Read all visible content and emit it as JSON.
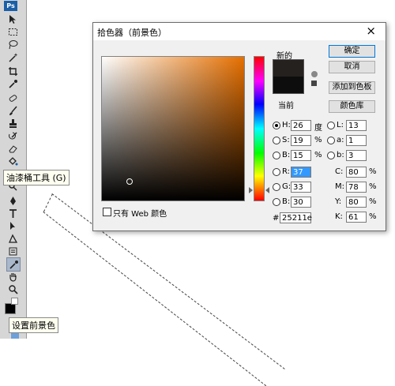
{
  "app": {
    "logo": "Ps"
  },
  "toolbar": {
    "tooltip_paint_bucket": "油漆桶工具 (G)",
    "tooltip_foreground": "设置前景色"
  },
  "dialog": {
    "title": "拾色器（前景色）",
    "close": "×",
    "swatch": {
      "new_label": "新的",
      "current_label": "当前"
    },
    "buttons": {
      "ok": "确定",
      "cancel": "取消",
      "add_to_swatches": "添加到色板",
      "color_libraries": "颜色库"
    },
    "web_only_label": "只有 Web 颜色",
    "hsb": {
      "h_label": "H:",
      "h_value": "26",
      "h_unit": "度",
      "s_label": "S:",
      "s_value": "19",
      "s_unit": "%",
      "b_label": "B:",
      "b_value": "15",
      "b_unit": "%"
    },
    "rgb": {
      "r_label": "R:",
      "r_value": "37",
      "g_label": "G:",
      "g_value": "33",
      "b_label": "B:",
      "b_value": "30"
    },
    "lab": {
      "l_label": "L:",
      "l_value": "13",
      "a_label": "a:",
      "a_value": "1",
      "b_label": "b:",
      "b_value": "3"
    },
    "cmyk": {
      "c_label": "C:",
      "c_value": "80",
      "m_label": "M:",
      "m_value": "78",
      "y_label": "Y:",
      "y_value": "80",
      "k_label": "K:",
      "k_value": "61",
      "unit": "%"
    },
    "hex_label": "#",
    "hex_value": "25211e"
  },
  "colors": {
    "foreground": "#25211e",
    "current": "#0d0d0d",
    "field_hue": "#e66f00"
  }
}
